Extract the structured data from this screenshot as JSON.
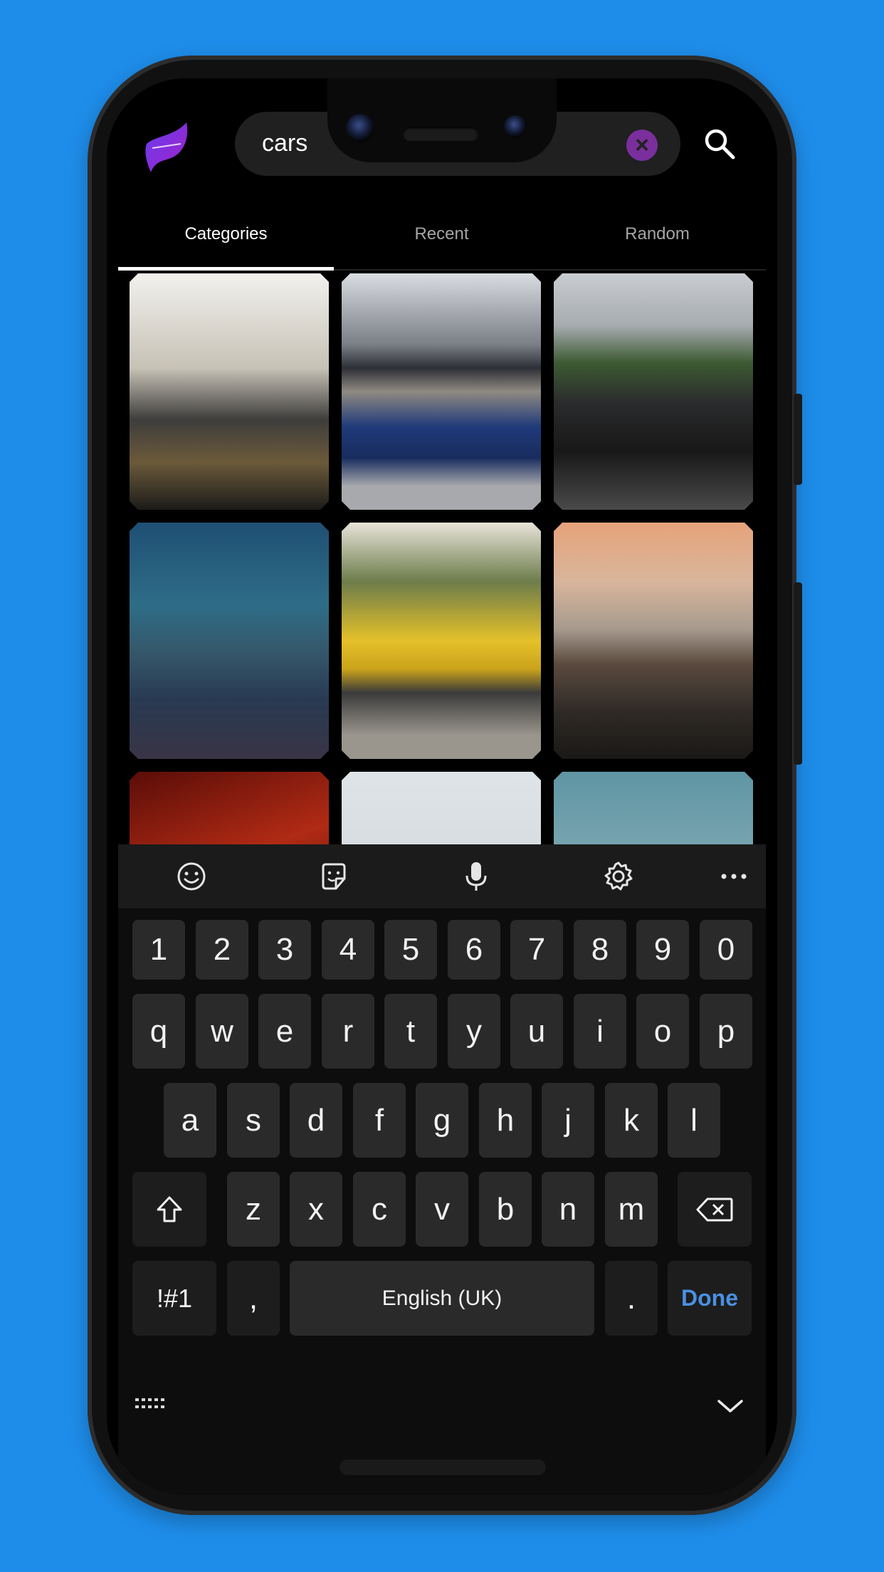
{
  "search": {
    "value": "cars"
  },
  "tabs": [
    {
      "label": "Categories",
      "active": true
    },
    {
      "label": "Recent",
      "active": false
    },
    {
      "label": "Random",
      "active": false
    }
  ],
  "keyboard": {
    "row_numbers": [
      "1",
      "2",
      "3",
      "4",
      "5",
      "6",
      "7",
      "8",
      "9",
      "0"
    ],
    "row_q": [
      "q",
      "w",
      "e",
      "r",
      "t",
      "y",
      "u",
      "i",
      "o",
      "p"
    ],
    "row_a": [
      "a",
      "s",
      "d",
      "f",
      "g",
      "h",
      "j",
      "k",
      "l"
    ],
    "row_z": [
      "z",
      "x",
      "c",
      "v",
      "b",
      "n",
      "m"
    ],
    "symbols_label": "!#1",
    "comma_label": ",",
    "space_label": "English (UK)",
    "period_label": ".",
    "done_label": "Done"
  },
  "colors": {
    "background": "#1E8DEA",
    "accent": "#4A90E2",
    "clear": "#7A2F9C"
  }
}
